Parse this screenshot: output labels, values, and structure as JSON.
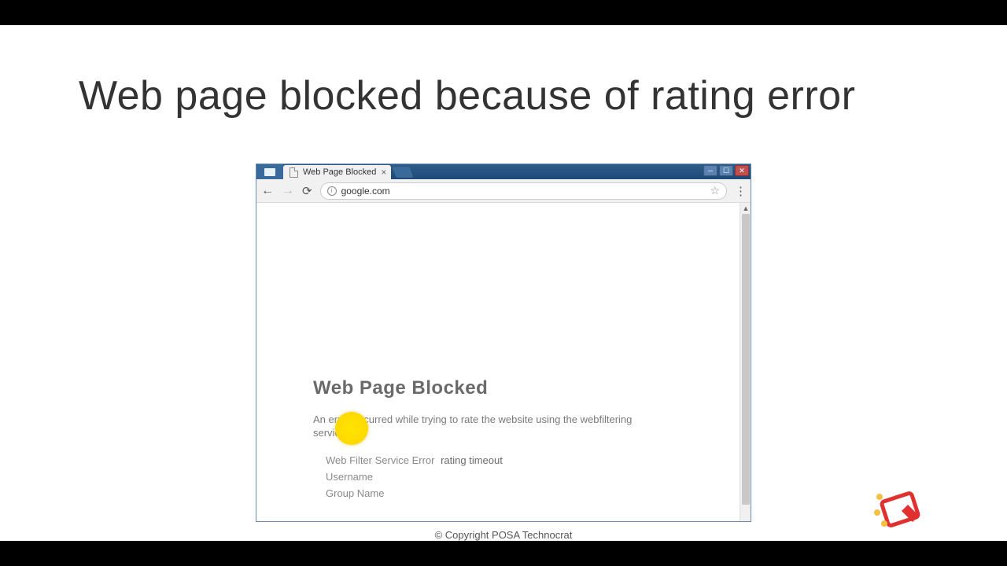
{
  "slide": {
    "title": "Web page blocked because of rating error",
    "footer": "© Copyright POSA Technocrat"
  },
  "browser": {
    "tab_label": "Web Page Blocked",
    "url": "google.com"
  },
  "block_page": {
    "heading": "Web Page Blocked",
    "description": "An error occurred while trying to rate the website using the webfiltering service.",
    "rows": [
      {
        "label": "Web Filter Service Error",
        "value": "rating timeout"
      },
      {
        "label": "Username",
        "value": ""
      },
      {
        "label": "Group Name",
        "value": ""
      }
    ]
  }
}
